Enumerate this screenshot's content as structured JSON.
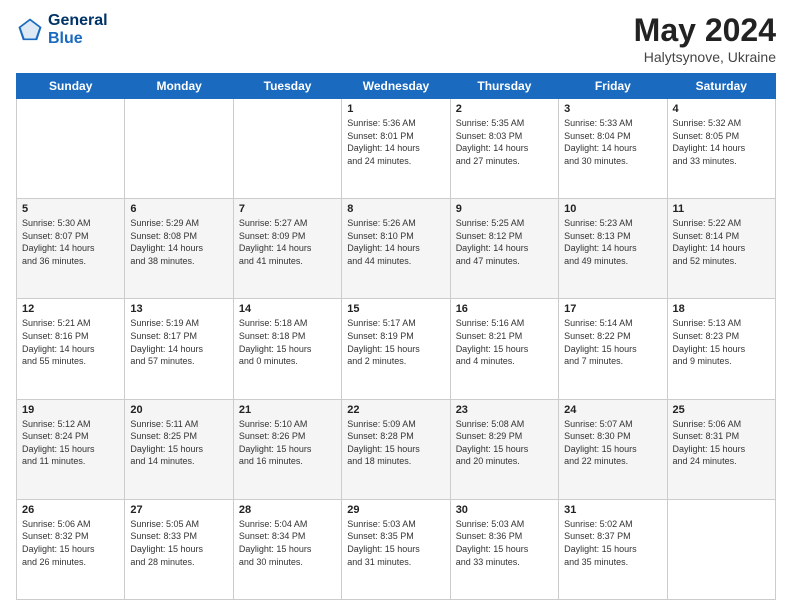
{
  "header": {
    "logo_line1": "General",
    "logo_line2": "Blue",
    "title": "May 2024",
    "subtitle": "Halytsynove, Ukraine"
  },
  "days_of_week": [
    "Sunday",
    "Monday",
    "Tuesday",
    "Wednesday",
    "Thursday",
    "Friday",
    "Saturday"
  ],
  "weeks": [
    [
      {
        "day": "",
        "info": ""
      },
      {
        "day": "",
        "info": ""
      },
      {
        "day": "",
        "info": ""
      },
      {
        "day": "1",
        "info": "Sunrise: 5:36 AM\nSunset: 8:01 PM\nDaylight: 14 hours\nand 24 minutes."
      },
      {
        "day": "2",
        "info": "Sunrise: 5:35 AM\nSunset: 8:03 PM\nDaylight: 14 hours\nand 27 minutes."
      },
      {
        "day": "3",
        "info": "Sunrise: 5:33 AM\nSunset: 8:04 PM\nDaylight: 14 hours\nand 30 minutes."
      },
      {
        "day": "4",
        "info": "Sunrise: 5:32 AM\nSunset: 8:05 PM\nDaylight: 14 hours\nand 33 minutes."
      }
    ],
    [
      {
        "day": "5",
        "info": "Sunrise: 5:30 AM\nSunset: 8:07 PM\nDaylight: 14 hours\nand 36 minutes."
      },
      {
        "day": "6",
        "info": "Sunrise: 5:29 AM\nSunset: 8:08 PM\nDaylight: 14 hours\nand 38 minutes."
      },
      {
        "day": "7",
        "info": "Sunrise: 5:27 AM\nSunset: 8:09 PM\nDaylight: 14 hours\nand 41 minutes."
      },
      {
        "day": "8",
        "info": "Sunrise: 5:26 AM\nSunset: 8:10 PM\nDaylight: 14 hours\nand 44 minutes."
      },
      {
        "day": "9",
        "info": "Sunrise: 5:25 AM\nSunset: 8:12 PM\nDaylight: 14 hours\nand 47 minutes."
      },
      {
        "day": "10",
        "info": "Sunrise: 5:23 AM\nSunset: 8:13 PM\nDaylight: 14 hours\nand 49 minutes."
      },
      {
        "day": "11",
        "info": "Sunrise: 5:22 AM\nSunset: 8:14 PM\nDaylight: 14 hours\nand 52 minutes."
      }
    ],
    [
      {
        "day": "12",
        "info": "Sunrise: 5:21 AM\nSunset: 8:16 PM\nDaylight: 14 hours\nand 55 minutes."
      },
      {
        "day": "13",
        "info": "Sunrise: 5:19 AM\nSunset: 8:17 PM\nDaylight: 14 hours\nand 57 minutes."
      },
      {
        "day": "14",
        "info": "Sunrise: 5:18 AM\nSunset: 8:18 PM\nDaylight: 15 hours\nand 0 minutes."
      },
      {
        "day": "15",
        "info": "Sunrise: 5:17 AM\nSunset: 8:19 PM\nDaylight: 15 hours\nand 2 minutes."
      },
      {
        "day": "16",
        "info": "Sunrise: 5:16 AM\nSunset: 8:21 PM\nDaylight: 15 hours\nand 4 minutes."
      },
      {
        "day": "17",
        "info": "Sunrise: 5:14 AM\nSunset: 8:22 PM\nDaylight: 15 hours\nand 7 minutes."
      },
      {
        "day": "18",
        "info": "Sunrise: 5:13 AM\nSunset: 8:23 PM\nDaylight: 15 hours\nand 9 minutes."
      }
    ],
    [
      {
        "day": "19",
        "info": "Sunrise: 5:12 AM\nSunset: 8:24 PM\nDaylight: 15 hours\nand 11 minutes."
      },
      {
        "day": "20",
        "info": "Sunrise: 5:11 AM\nSunset: 8:25 PM\nDaylight: 15 hours\nand 14 minutes."
      },
      {
        "day": "21",
        "info": "Sunrise: 5:10 AM\nSunset: 8:26 PM\nDaylight: 15 hours\nand 16 minutes."
      },
      {
        "day": "22",
        "info": "Sunrise: 5:09 AM\nSunset: 8:28 PM\nDaylight: 15 hours\nand 18 minutes."
      },
      {
        "day": "23",
        "info": "Sunrise: 5:08 AM\nSunset: 8:29 PM\nDaylight: 15 hours\nand 20 minutes."
      },
      {
        "day": "24",
        "info": "Sunrise: 5:07 AM\nSunset: 8:30 PM\nDaylight: 15 hours\nand 22 minutes."
      },
      {
        "day": "25",
        "info": "Sunrise: 5:06 AM\nSunset: 8:31 PM\nDaylight: 15 hours\nand 24 minutes."
      }
    ],
    [
      {
        "day": "26",
        "info": "Sunrise: 5:06 AM\nSunset: 8:32 PM\nDaylight: 15 hours\nand 26 minutes."
      },
      {
        "day": "27",
        "info": "Sunrise: 5:05 AM\nSunset: 8:33 PM\nDaylight: 15 hours\nand 28 minutes."
      },
      {
        "day": "28",
        "info": "Sunrise: 5:04 AM\nSunset: 8:34 PM\nDaylight: 15 hours\nand 30 minutes."
      },
      {
        "day": "29",
        "info": "Sunrise: 5:03 AM\nSunset: 8:35 PM\nDaylight: 15 hours\nand 31 minutes."
      },
      {
        "day": "30",
        "info": "Sunrise: 5:03 AM\nSunset: 8:36 PM\nDaylight: 15 hours\nand 33 minutes."
      },
      {
        "day": "31",
        "info": "Sunrise: 5:02 AM\nSunset: 8:37 PM\nDaylight: 15 hours\nand 35 minutes."
      },
      {
        "day": "",
        "info": ""
      }
    ]
  ]
}
